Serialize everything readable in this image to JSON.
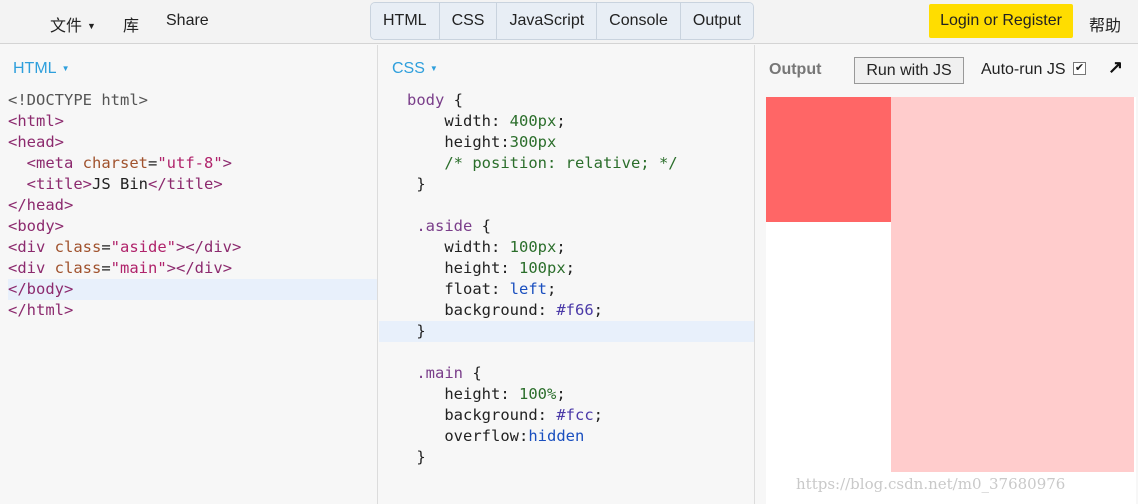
{
  "topbar": {
    "file_menu": "文件",
    "library": "库",
    "share": "Share",
    "tabs": [
      "HTML",
      "CSS",
      "JavaScript",
      "Console",
      "Output"
    ],
    "login_label": "Login or Register",
    "help_label": "帮助"
  },
  "html_panel": {
    "label": "HTML",
    "lines": [
      "<!DOCTYPE html>",
      "<html>",
      "<head>",
      "  <meta charset=\"utf-8\">",
      "  <title>JS Bin</title>",
      "</head>",
      "<body>",
      "<div class=\"aside\"></div>",
      "<div class=\"main\"></div>",
      "</body>",
      "</html>"
    ]
  },
  "css_panel": {
    "label": "CSS",
    "lines": [
      "   body {",
      "       width: 400px;",
      "       height:300px",
      "       /* position: relative; */",
      "    }",
      "",
      "    .aside {",
      "       width: 100px;",
      "       height: 100px;",
      "       float: left;",
      "       background: #f66;",
      "    }",
      "",
      "    .main {",
      "       height: 100%;",
      "       background: #fcc;",
      "       overflow:hidden",
      "    }"
    ]
  },
  "output_panel": {
    "label": "Output",
    "run_label": "Run with JS",
    "autorun_label": "Auto-run JS",
    "autorun_checked": true,
    "popout_icon": "arrow-up-right-icon",
    "aside_color": "#ff6666",
    "main_color": "#ffcccc"
  },
  "watermark": "https://blog.csdn.net/m0_37680976"
}
